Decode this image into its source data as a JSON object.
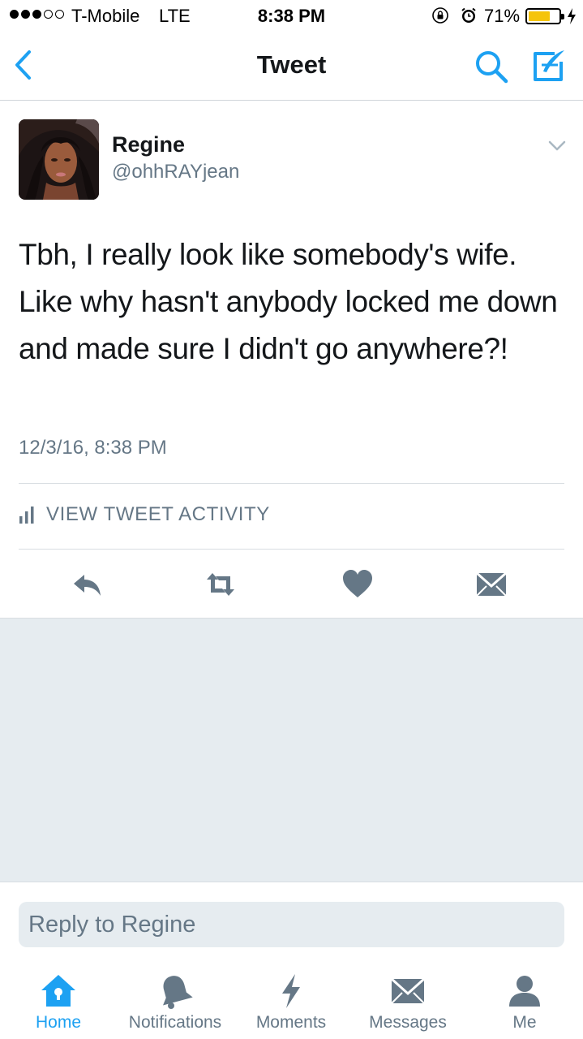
{
  "status_bar": {
    "carrier": "T-Mobile",
    "network": "LTE",
    "time": "8:38 PM",
    "battery": "71%",
    "battery_level": 0.71,
    "signal_bars": 3,
    "signal_total": 5
  },
  "nav": {
    "title": "Tweet",
    "icons": [
      "chevron-left-icon",
      "search-icon",
      "compose-icon"
    ]
  },
  "tweet": {
    "author_name": "Regine",
    "author_handle": "@ohhRAYjean",
    "text": "Tbh, I really look like somebody's wife. Like why hasn't anybody locked me down and made sure I didn't go anywhere?!",
    "timestamp": "12/3/16, 8:38 PM",
    "activity_label": "VIEW TWEET ACTIVITY",
    "actions": [
      "reply-icon",
      "retweet-icon",
      "heart-icon",
      "direct-message-icon"
    ]
  },
  "reply": {
    "placeholder": "Reply to Regine"
  },
  "tabs": [
    {
      "label": "Home",
      "icon": "home-icon",
      "active": true
    },
    {
      "label": "Notifications",
      "icon": "bell-icon",
      "active": false
    },
    {
      "label": "Moments",
      "icon": "lightning-icon",
      "active": false
    },
    {
      "label": "Messages",
      "icon": "envelope-icon",
      "active": false
    },
    {
      "label": "Me",
      "icon": "person-icon",
      "active": false
    }
  ],
  "colors": {
    "accent": "#1da1f2",
    "text_primary": "#14171a",
    "text_secondary": "#657786",
    "battery": "#f5c40c",
    "background_gray": "#e6ecf0"
  }
}
